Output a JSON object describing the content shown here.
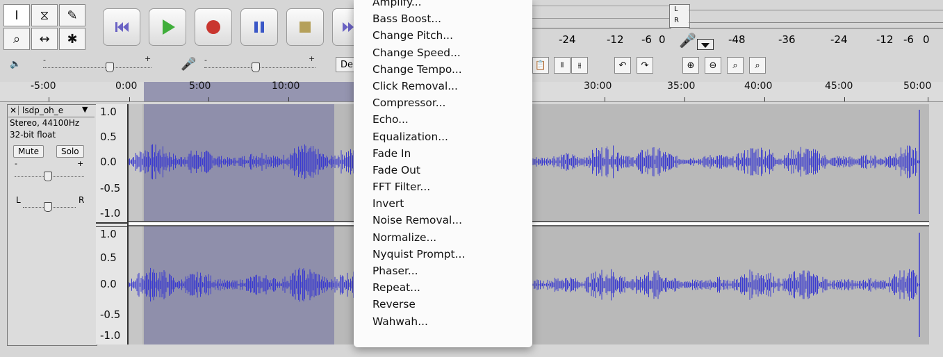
{
  "tools": {
    "labels": [
      "I",
      "⧖",
      "✎",
      "⌕",
      "↔",
      "✱"
    ]
  },
  "transport": {
    "buttons": [
      "skip-to-start",
      "play",
      "record",
      "pause",
      "stop",
      "skip-to-end"
    ]
  },
  "meters": {
    "playback_scale": [
      "-24",
      "-12",
      "-6",
      "0"
    ],
    "record_scale": [
      "-48",
      "-36",
      "-24",
      "-12",
      "-6",
      "0"
    ],
    "channel_left": "L",
    "channel_right": "R",
    "device_partial": "De"
  },
  "mixer": {
    "minus": "-",
    "plus": "+"
  },
  "ruler": {
    "labels": [
      "-5:00",
      "0:00",
      "5:00",
      "10:00",
      "30:00",
      "35:00",
      "40:00",
      "45:00",
      "50:00"
    ]
  },
  "track": {
    "name": "lsdp_oh_e",
    "info_rate": "Stereo, 44100Hz",
    "info_format": "32-bit float",
    "mute_label": "Mute",
    "solo_label": "Solo",
    "gain_minus": "-",
    "gain_plus": "+",
    "pan_left": "L",
    "pan_right": "R",
    "scale_top": [
      "1.0",
      "0.5",
      "0.0",
      "-0.5",
      "-1.0"
    ],
    "scale_bottom": [
      "1.0",
      "0.5",
      "0.0",
      "-0.5",
      "-1.0"
    ]
  },
  "effect_menu": {
    "items": [
      "Amplify...",
      "Bass Boost...",
      "Change Pitch...",
      "Change Speed...",
      "Change Tempo...",
      "Click Removal...",
      "Compressor...",
      "Echo...",
      "Equalization...",
      "Fade In",
      "Fade Out",
      "FFT Filter...",
      "Invert",
      "Noise Removal...",
      "Normalize...",
      "Nyquist Prompt...",
      "Phaser...",
      "Repeat...",
      "Reverse",
      "Wahwah..."
    ]
  },
  "colors": {
    "waveform": "#3a3acf",
    "selection": "#8f8fab",
    "track_bg": "#b9b9b9"
  }
}
